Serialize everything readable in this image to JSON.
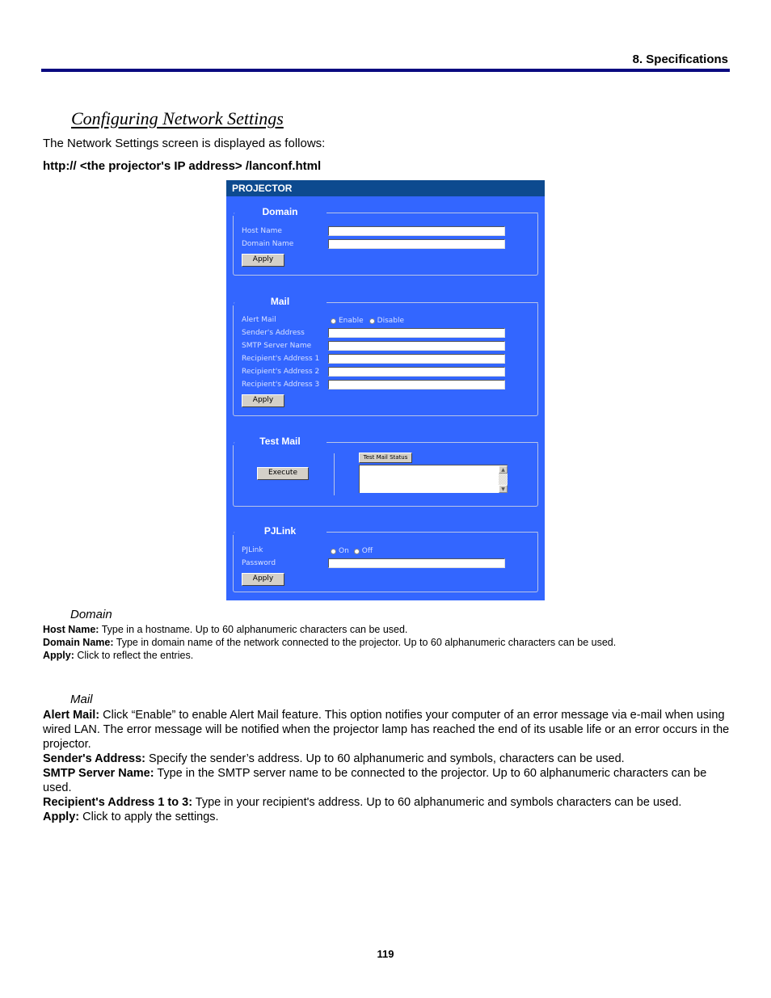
{
  "header": {
    "running_head": "8. Specifications"
  },
  "section": {
    "title": "Configuring Network Settings",
    "intro": "The Network Settings screen is displayed as follows:",
    "url": "http:// <the projector's IP address> /lanconf.html"
  },
  "panel": {
    "title": "PROJECTOR",
    "domain": {
      "legend": "Domain",
      "host_name_label": "Host Name",
      "host_name_value": "",
      "domain_name_label": "Domain Name",
      "domain_name_value": "",
      "apply_label": "Apply"
    },
    "mail": {
      "legend": "Mail",
      "alert_mail_label": "Alert Mail",
      "enable_label": "Enable",
      "disable_label": "Disable",
      "senders_address_label": "Sender's Address",
      "smtp_server_label": "SMTP Server Name",
      "recipient1_label": "Recipient's Address 1",
      "recipient2_label": "Recipient's Address 2",
      "recipient3_label": "Recipient's Address 3",
      "apply_label": "Apply"
    },
    "test_mail": {
      "legend": "Test Mail",
      "execute_label": "Execute",
      "status_label": "Test Mail Status",
      "status_text": ""
    },
    "pjlink": {
      "legend": "PJLink",
      "pjlink_label": "PJLink",
      "on_label": "On",
      "off_label": "Off",
      "password_label": "Password",
      "apply_label": "Apply"
    }
  },
  "domain_desc": {
    "heading": "Domain",
    "items": [
      {
        "term": "Host Name:",
        "text": " Type in a hostname. Up to 60 alphanumeric characters can be used."
      },
      {
        "term": "Domain Name:",
        "text": " Type in domain name of the network connected to the projector. Up to 60 alphanumeric characters can be used."
      },
      {
        "term": "Apply:",
        "text": " Click to reflect the entries."
      }
    ]
  },
  "mail_desc": {
    "heading": "Mail",
    "items": [
      {
        "term": "Alert Mail:",
        "text": " Click “Enable” to enable Alert Mail feature. This option notifies your computer of an error message via e-mail when using wired LAN. The error message will be notified when the projector lamp has reached the end of its usable life or an error occurs in the projector."
      },
      {
        "term": "Sender's Address:",
        "text": " Specify the sender’s address. Up to 60 alphanumeric and symbols, characters can be used."
      },
      {
        "term": "SMTP Server Name:",
        "text": " Type in the SMTP server name to be connected to the projector. Up to 60 alphanumeric characters can be used."
      },
      {
        "term": "Recipient's Address 1 to 3:",
        "text": " Type in your recipient's address. Up to 60 alphanumeric and symbols characters can be used."
      },
      {
        "term": "Apply:",
        "text": " Click to apply the settings."
      }
    ]
  },
  "footer": {
    "page_number": "119"
  }
}
